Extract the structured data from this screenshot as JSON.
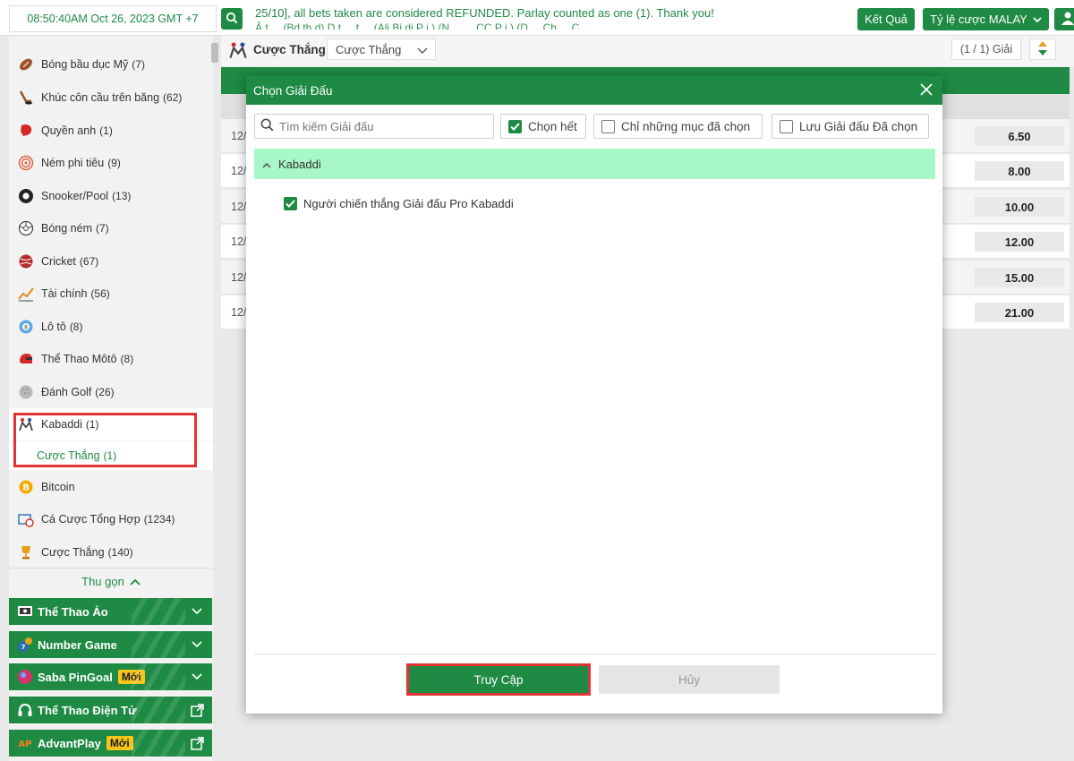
{
  "topbar": {
    "clock": "08:50:40AM Oct 26, 2023 GMT +7",
    "ticker_line1": "25/10], all bets taken are considered REFUNDED. Parlay counted as one (1). Thank you!",
    "ticker_line2": "Ả t ... (Bd  th d) D  t  ... t  ...  (Ali Bi  di P  i ) (N ...  ... CC P  i  ) (D  ... Ch  ... C  ...",
    "results_label": "Kết Quả",
    "odds_type_label": "Tỷ lệ cược MALAY"
  },
  "sidebar": {
    "items": [
      {
        "label": "Bóng bầu dục Mỹ",
        "count": "(7)",
        "icon": "american-football-icon"
      },
      {
        "label": "Khúc côn cầu trên băng",
        "count": "(62)",
        "icon": "ice-hockey-icon"
      },
      {
        "label": "Quyền anh",
        "count": "(1)",
        "icon": "boxing-glove-icon"
      },
      {
        "label": "Ném phi tiêu",
        "count": "(9)",
        "icon": "darts-icon"
      },
      {
        "label": "Snooker/Pool",
        "count": "(13)",
        "icon": "billiard-ball-icon"
      },
      {
        "label": "Bóng ném",
        "count": "(7)",
        "icon": "handball-icon"
      },
      {
        "label": "Cricket",
        "count": "(67)",
        "icon": "cricket-ball-icon"
      },
      {
        "label": "Tài chính",
        "count": "(56)",
        "icon": "finance-chart-icon"
      },
      {
        "label": "Lô tô",
        "count": "(8)",
        "icon": "lotto-ball-icon"
      },
      {
        "label": "Thể Thao Môtô",
        "count": "(8)",
        "icon": "motorsport-helmet-icon"
      },
      {
        "label": "Đánh Golf",
        "count": "(26)",
        "icon": "golf-ball-icon"
      },
      {
        "label": "Kabaddi",
        "count": "(1)",
        "icon": "kabaddi-icon"
      }
    ],
    "sub_item": {
      "label": "Cược Thắng",
      "count": "(1)"
    },
    "items_after": [
      {
        "label": "Bitcoin",
        "count": "",
        "icon": "bitcoin-icon"
      },
      {
        "label": "Cá Cược Tổng Hợp",
        "count": "(1234)",
        "icon": "combo-bet-icon"
      },
      {
        "label": "Cược Thắng",
        "count": "(140)",
        "icon": "trophy-icon"
      }
    ],
    "collapse_label": "Thu gọn",
    "categories": [
      {
        "label": "Thể Thao Ảo",
        "badge": "",
        "icon": "virtual-sports-icon",
        "end": "chevron"
      },
      {
        "label": "Number Game",
        "badge": "",
        "icon": "number-game-icon",
        "end": "chevron"
      },
      {
        "label": "Saba PinGoal",
        "badge": "Mới",
        "icon": "pingoal-icon",
        "end": "chevron"
      },
      {
        "label": "Thể Thao Điện Tử",
        "badge": "",
        "icon": "esports-headset-icon",
        "end": "external"
      },
      {
        "label": "AdvantPlay",
        "badge": "Mới",
        "icon": "advantplay-icon",
        "end": "external"
      }
    ]
  },
  "main": {
    "title": "Cược Thắng",
    "market_select": "Cược Thắng",
    "league_count": "(1 / 1) Giải",
    "rows": [
      {
        "date": "12/",
        "odds": "6.50"
      },
      {
        "date": "12/",
        "odds": "8.00"
      },
      {
        "date": "12/",
        "odds": "10.00"
      },
      {
        "date": "12/",
        "odds": "12.00"
      },
      {
        "date": "12/",
        "odds": "15.00"
      },
      {
        "date": "12/",
        "odds": "21.00"
      }
    ]
  },
  "modal": {
    "title": "Chọn Giải Đấu",
    "search_placeholder": "Tìm kiếm Giải đấu",
    "select_all": "Chọn hết",
    "only_selected": "Chỉ những mục đã chọn",
    "save_selected": "Lưu Giải đấu Đã chọn",
    "group": "Kabaddi",
    "league": "Người chiến thắng Giải đấu Pro Kabaddi",
    "access": "Truy Cập",
    "cancel": "Hủy"
  },
  "colors": {
    "brand_green": "#1e8a44",
    "group_highlight": "#a8f7c8",
    "annotation_red": "#e03434",
    "badge_yellow": "#f5c518"
  }
}
